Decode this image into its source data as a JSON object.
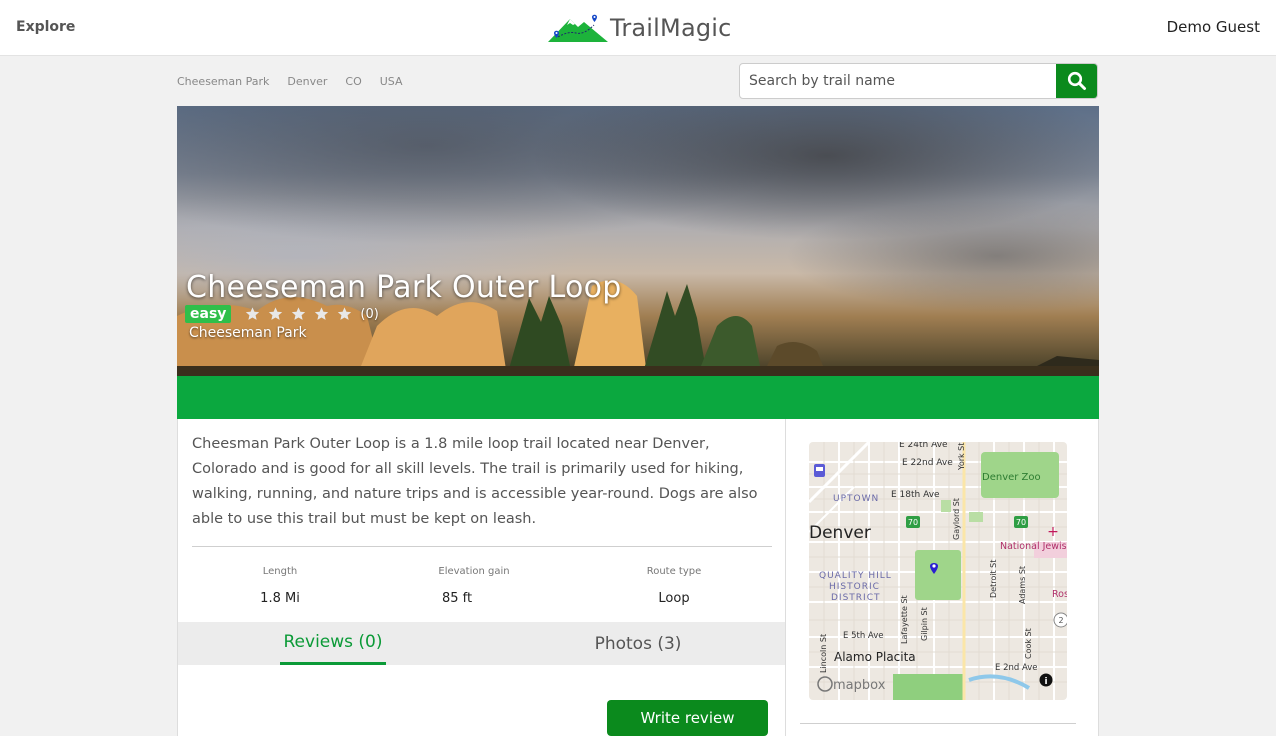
{
  "nav": {
    "explore": "Explore",
    "brand": "TrailMagic",
    "user": "Demo Guest"
  },
  "breadcrumb": [
    "Cheeseman Park",
    "Denver",
    "CO",
    "USA"
  ],
  "search": {
    "placeholder": "Search by trail name",
    "icon": "search-icon"
  },
  "hero": {
    "title": "Cheeseman Park Outer Loop",
    "difficulty": "easy",
    "rating": 0,
    "rating_max": 5,
    "rating_count": "(0)",
    "park": "Cheeseman Park"
  },
  "trail": {
    "description": "Cheesman Park Outer Loop is a 1.8 mile loop trail located near Denver, Colorado and is good for all skill levels. The trail is primarily used for hiking, walking, running, and nature trips and is accessible year-round. Dogs are also able to use this trail but must be kept on leash.",
    "stats": [
      {
        "label": "Length",
        "value": "1.8 Mi"
      },
      {
        "label": "Elevation gain",
        "value": "85 ft"
      },
      {
        "label": "Route type",
        "value": "Loop"
      }
    ]
  },
  "tabs": {
    "reviews": "Reviews (0)",
    "photos": "Photos (3)",
    "active": "reviews"
  },
  "actions": {
    "write_review": "Write review"
  },
  "map": {
    "streets": [
      "E 24th Ave",
      "E 22nd Ave",
      "E 18th Ave",
      "E 5th Ave",
      "E 2nd Ave",
      "York St",
      "Gaylord St",
      "Detroit St",
      "Adams St",
      "Lafayette St",
      "Gilpin St",
      "Lincoln St",
      "Cook St"
    ],
    "places": [
      "Denver Zoo",
      "UPTOWN",
      "Denver",
      "QUALITY HILL",
      "HISTORIC",
      "DISTRICT",
      "National Jewis",
      "Ros",
      "Alamo Placita"
    ],
    "highway_shields": [
      "70",
      "70",
      "2"
    ],
    "attribution": "mapbox",
    "info_icon": "info-icon",
    "marker_icon": "location-pin-icon"
  },
  "colors": {
    "primary_green": "#0b8a1d",
    "banner_green": "#0ba83f",
    "easy_badge": "#2fbf4a",
    "active_tab": "#0b9a37"
  }
}
